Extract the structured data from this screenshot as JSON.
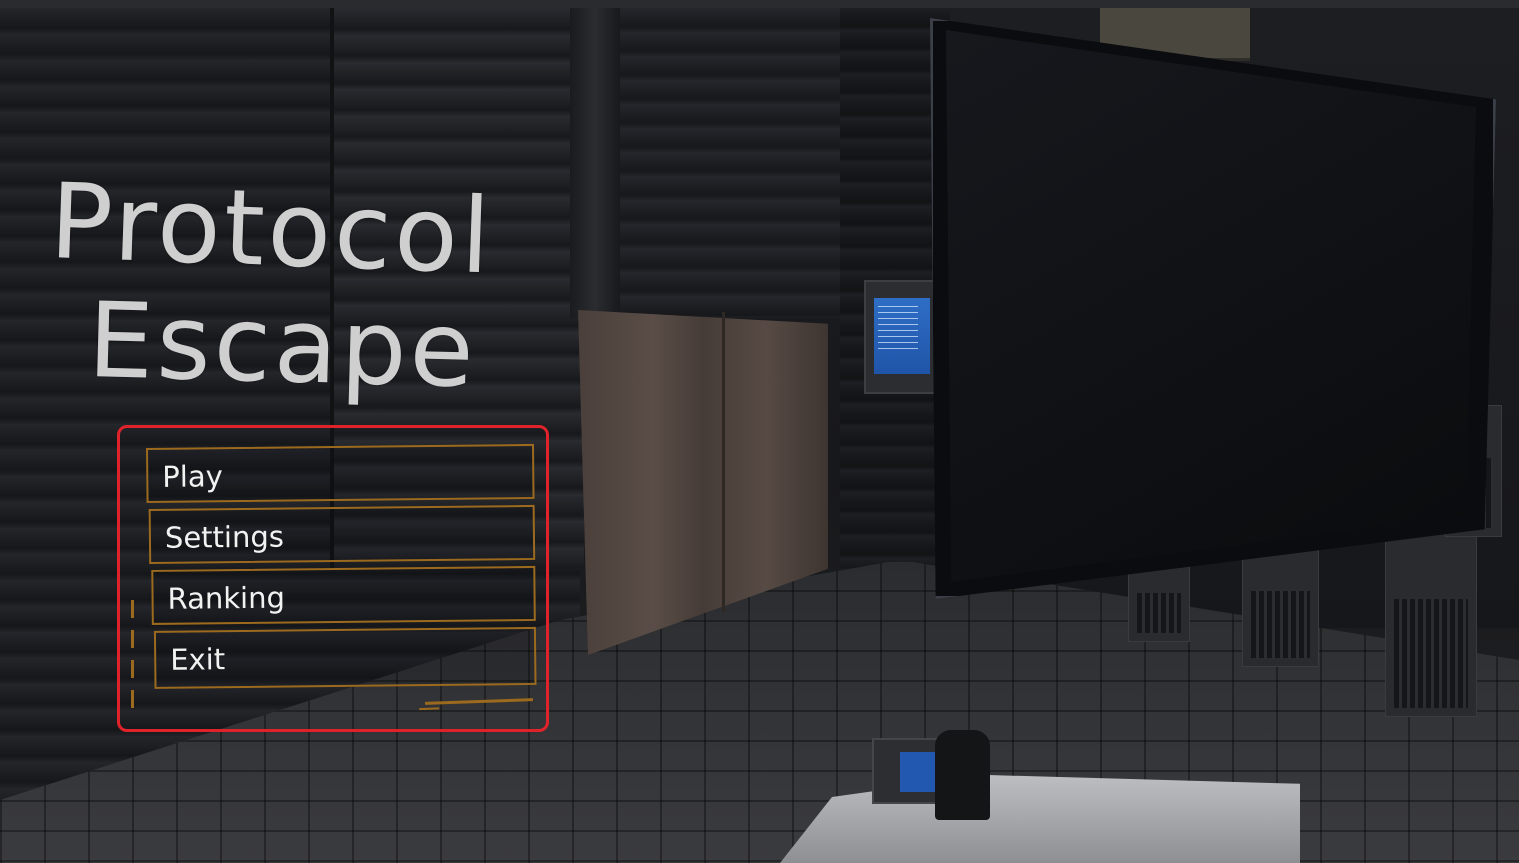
{
  "game": {
    "title_line1": "Protocol",
    "title_line2": "Escape"
  },
  "menu": {
    "items": [
      {
        "id": "play",
        "label": "Play"
      },
      {
        "id": "settings",
        "label": "Settings"
      },
      {
        "id": "ranking",
        "label": "Ranking"
      },
      {
        "id": "exit",
        "label": "Exit"
      }
    ],
    "highlight_color": "#e0232b",
    "border_color": "#9c6a1e"
  }
}
